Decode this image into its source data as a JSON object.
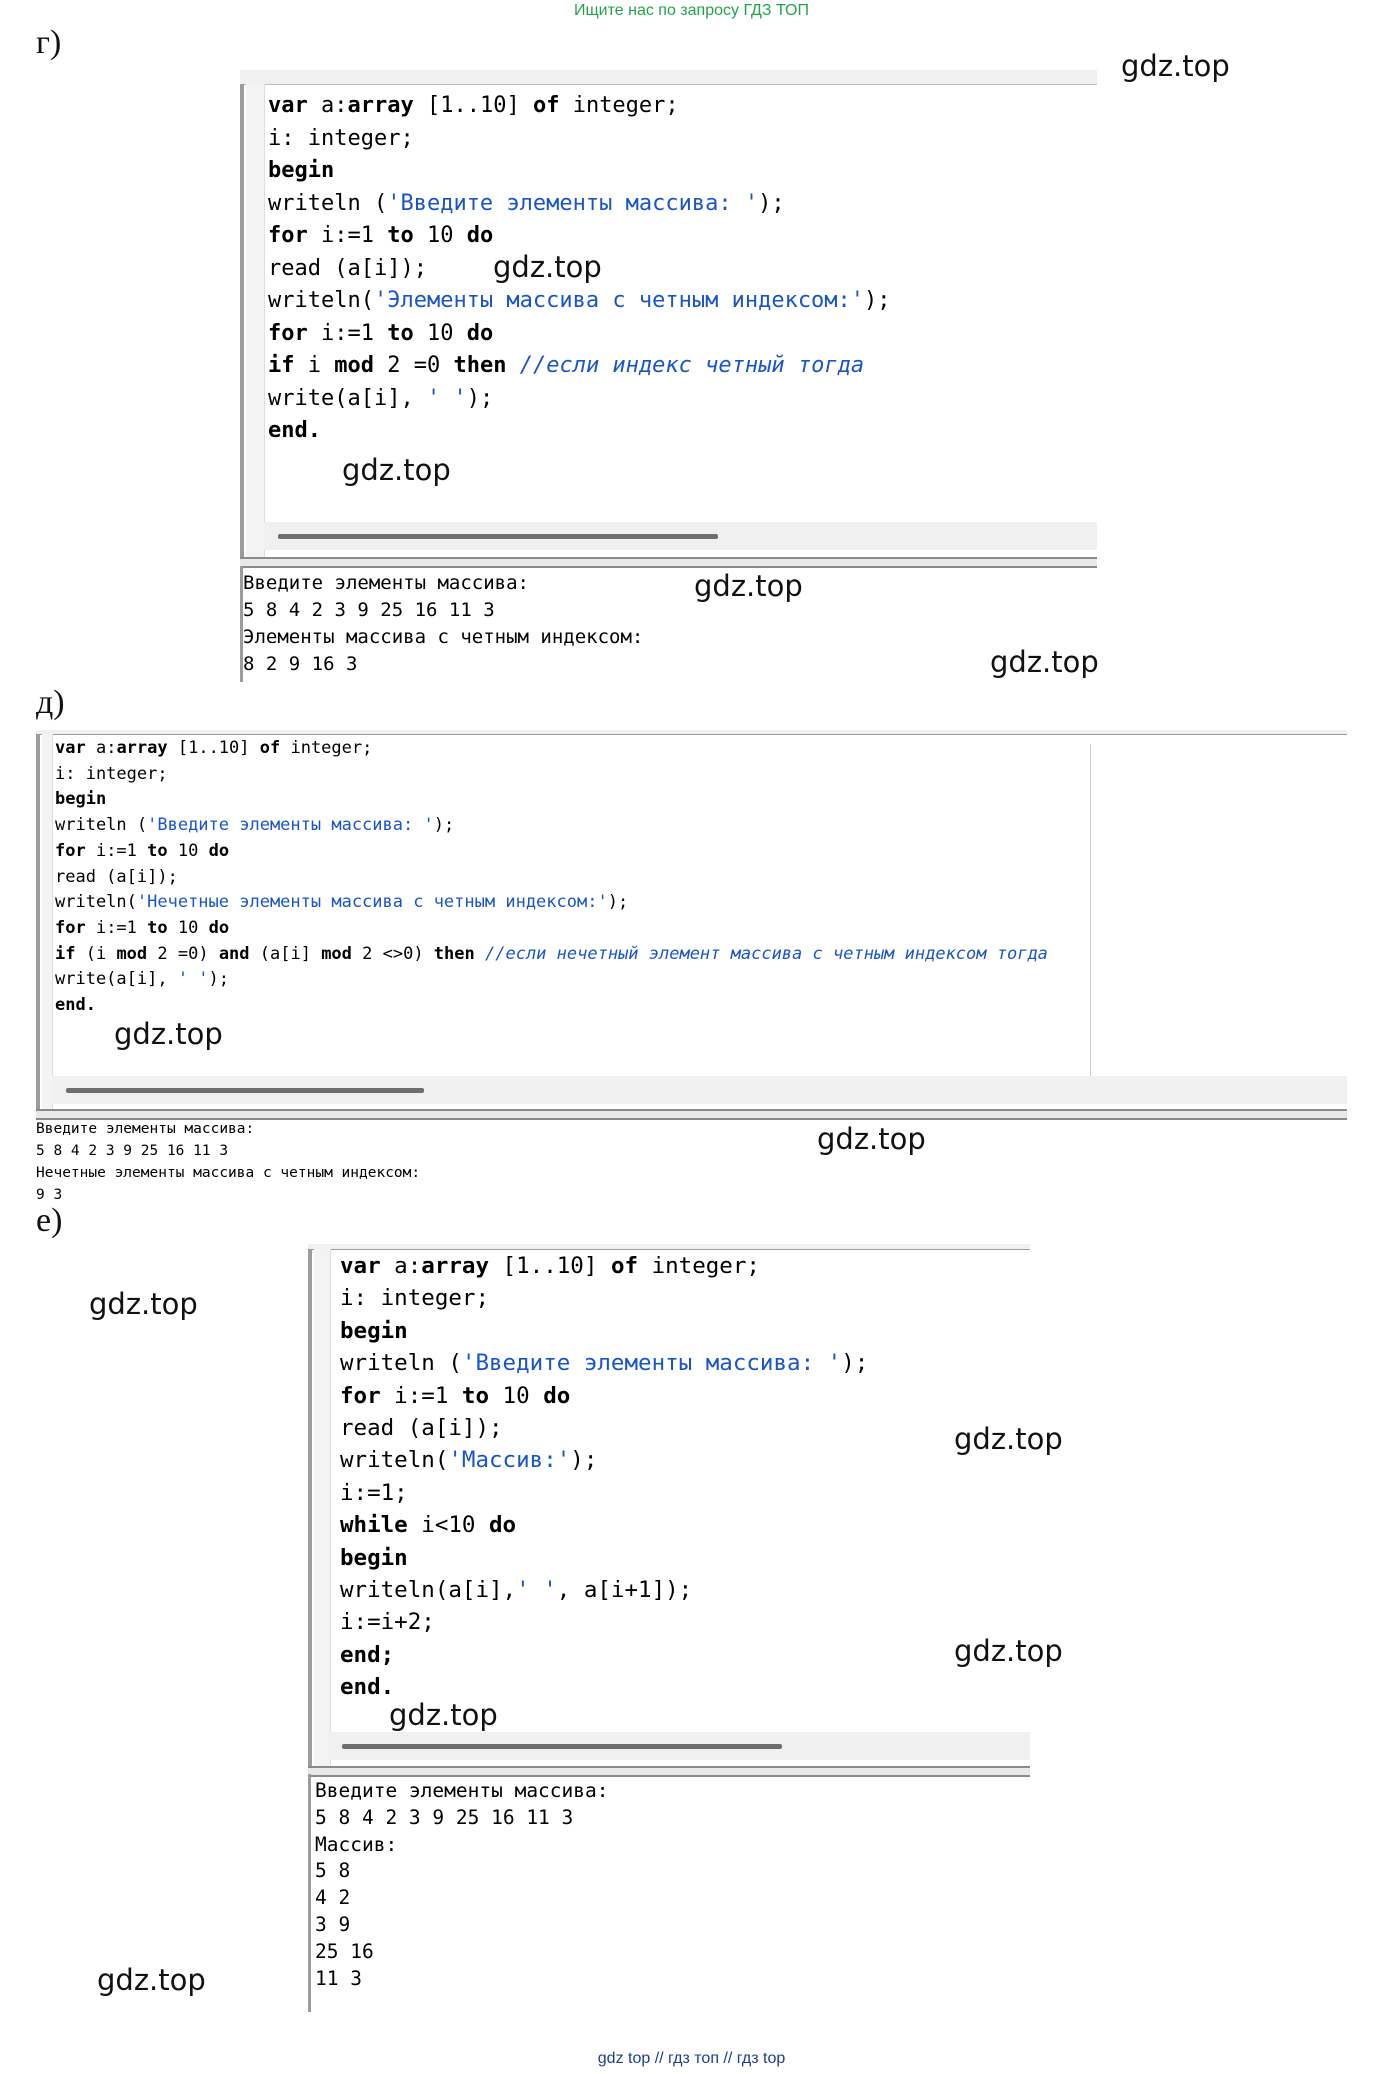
{
  "header_banner": "Ищите нас по запросу ГДЗ ТОП",
  "footer_banner": "gdz top  //  гдз топ  //  гдз top",
  "watermark": "gdz.top",
  "sections": {
    "g": {
      "letter": "г)",
      "code": [
        [
          {
            "t": "var",
            "k": "kw"
          },
          {
            "t": " a:"
          },
          {
            "t": "array",
            "k": "kw"
          },
          {
            "t": " [1..10] "
          },
          {
            "t": "of",
            "k": "kw"
          },
          {
            "t": " integer;"
          }
        ],
        [
          {
            "t": "i: integer;"
          }
        ],
        [
          {
            "t": "begin",
            "k": "kw"
          }
        ],
        [
          {
            "t": "writeln ("
          },
          {
            "t": "'Введите элементы массива: '",
            "k": "str"
          },
          {
            "t": ");"
          }
        ],
        [
          {
            "t": "for",
            "k": "kw"
          },
          {
            "t": " i:=1 "
          },
          {
            "t": "to",
            "k": "kw"
          },
          {
            "t": " 10 "
          },
          {
            "t": "do",
            "k": "kw"
          }
        ],
        [
          {
            "t": "read (a[i]);"
          }
        ],
        [
          {
            "t": "writeln("
          },
          {
            "t": "'Элементы массива с четным индексом:'",
            "k": "str"
          },
          {
            "t": ");"
          }
        ],
        [
          {
            "t": "for",
            "k": "kw"
          },
          {
            "t": " i:=1 "
          },
          {
            "t": "to",
            "k": "kw"
          },
          {
            "t": " 10 "
          },
          {
            "t": "do",
            "k": "kw"
          }
        ],
        [
          {
            "t": "if",
            "k": "kw"
          },
          {
            "t": " i "
          },
          {
            "t": "mod",
            "k": "kw"
          },
          {
            "t": " 2 =0 "
          },
          {
            "t": "then",
            "k": "kw"
          },
          {
            "t": " "
          },
          {
            "t": "//если индекс четный тогда",
            "k": "cmt"
          }
        ],
        [
          {
            "t": "write(a[i], "
          },
          {
            "t": "' '",
            "k": "str"
          },
          {
            "t": ");"
          }
        ],
        [
          {
            "t": "end.",
            "k": "kw"
          }
        ]
      ],
      "output": [
        "Введите элементы массива:",
        "5 8 4 2 3 9 25 16 11 3",
        "Элементы массива с четным индексом:",
        "8 2 9 16 3"
      ]
    },
    "d": {
      "letter": "д)",
      "code": [
        [
          {
            "t": "var",
            "k": "kw"
          },
          {
            "t": " a:"
          },
          {
            "t": "array",
            "k": "kw"
          },
          {
            "t": " [1..10] "
          },
          {
            "t": "of",
            "k": "kw"
          },
          {
            "t": " integer;"
          }
        ],
        [
          {
            "t": "i: integer;"
          }
        ],
        [
          {
            "t": "begin",
            "k": "kw"
          }
        ],
        [
          {
            "t": "writeln ("
          },
          {
            "t": "'Введите элементы массива: '",
            "k": "str"
          },
          {
            "t": ");"
          }
        ],
        [
          {
            "t": "for",
            "k": "kw"
          },
          {
            "t": " i:=1 "
          },
          {
            "t": "to",
            "k": "kw"
          },
          {
            "t": " 10 "
          },
          {
            "t": "do",
            "k": "kw"
          }
        ],
        [
          {
            "t": "read (a[i]);"
          }
        ],
        [
          {
            "t": "writeln("
          },
          {
            "t": "'Нечетные элементы массива с четным индексом:'",
            "k": "str"
          },
          {
            "t": ");"
          }
        ],
        [
          {
            "t": "for",
            "k": "kw"
          },
          {
            "t": " i:=1 "
          },
          {
            "t": "to",
            "k": "kw"
          },
          {
            "t": " 10 "
          },
          {
            "t": "do",
            "k": "kw"
          }
        ],
        [
          {
            "t": "if",
            "k": "kw"
          },
          {
            "t": " (i "
          },
          {
            "t": "mod",
            "k": "kw"
          },
          {
            "t": " 2 =0) "
          },
          {
            "t": "and",
            "k": "kw"
          },
          {
            "t": " (a[i] "
          },
          {
            "t": "mod",
            "k": "kw"
          },
          {
            "t": " 2 <>0) "
          },
          {
            "t": "then",
            "k": "kw"
          },
          {
            "t": " "
          },
          {
            "t": "//если нечетный элемент массива с четным индексом тогда",
            "k": "cmt"
          }
        ],
        [
          {
            "t": "write(a[i], "
          },
          {
            "t": "' '",
            "k": "str"
          },
          {
            "t": ");"
          }
        ],
        [
          {
            "t": "end.",
            "k": "kw"
          }
        ]
      ],
      "output": [
        "Введите элементы массива:",
        "5 8 4 2 3 9 25 16 11 3",
        "Нечетные элементы массива с четным индексом:",
        "9 3"
      ]
    },
    "e": {
      "letter": "е)",
      "code": [
        [
          {
            "t": "var",
            "k": "kw"
          },
          {
            "t": " a:"
          },
          {
            "t": "array",
            "k": "kw"
          },
          {
            "t": " [1..10] "
          },
          {
            "t": "of",
            "k": "kw"
          },
          {
            "t": " integer;"
          }
        ],
        [
          {
            "t": "i: integer;"
          }
        ],
        [
          {
            "t": "begin",
            "k": "kw"
          }
        ],
        [
          {
            "t": "writeln ("
          },
          {
            "t": "'Введите элементы массива: '",
            "k": "str"
          },
          {
            "t": ");"
          }
        ],
        [
          {
            "t": "for",
            "k": "kw"
          },
          {
            "t": " i:=1 "
          },
          {
            "t": "to",
            "k": "kw"
          },
          {
            "t": " 10 "
          },
          {
            "t": "do",
            "k": "kw"
          }
        ],
        [
          {
            "t": "read (a[i]);"
          }
        ],
        [
          {
            "t": "writeln("
          },
          {
            "t": "'Массив:'",
            "k": "str"
          },
          {
            "t": ");"
          }
        ],
        [
          {
            "t": "i:=1;"
          }
        ],
        [
          {
            "t": "while",
            "k": "kw"
          },
          {
            "t": " i<10 "
          },
          {
            "t": "do",
            "k": "kw"
          }
        ],
        [
          {
            "t": "begin",
            "k": "kw"
          }
        ],
        [
          {
            "t": "writeln(a[i],"
          },
          {
            "t": "' '",
            "k": "str"
          },
          {
            "t": ", a[i+1]);"
          }
        ],
        [
          {
            "t": "i:=i+2;"
          }
        ],
        [
          {
            "t": "end;",
            "k": "kw"
          }
        ],
        [
          {
            "t": "end.",
            "k": "kw"
          }
        ]
      ],
      "output": [
        "Введите элементы массива:",
        "5 8 4 2 3 9 25 16 11 3",
        "Массив:",
        "5 8",
        "4 2",
        "3 9",
        "25 16",
        "11 3"
      ]
    }
  }
}
